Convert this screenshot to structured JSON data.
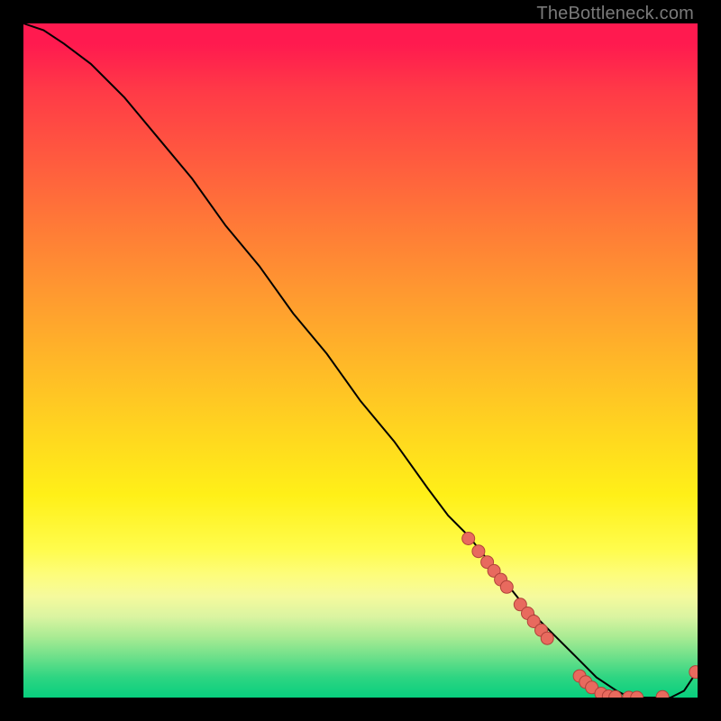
{
  "watermark": "TheBottleneck.com",
  "colors": {
    "background": "#000000",
    "curve_stroke": "#000000",
    "marker_fill": "#e86a5e",
    "marker_stroke": "#b0423a"
  },
  "chart_data": {
    "type": "line",
    "title": "",
    "xlabel": "",
    "ylabel": "",
    "xlim": [
      0,
      100
    ],
    "ylim": [
      0,
      100
    ],
    "grid": false,
    "legend": false,
    "series": [
      {
        "name": "bottleneck-curve",
        "x": [
          0,
          3,
          6,
          10,
          15,
          20,
          25,
          30,
          35,
          40,
          45,
          50,
          55,
          60,
          63,
          66,
          70,
          74,
          78,
          82,
          85,
          88,
          90,
          92,
          94,
          96,
          98,
          100
        ],
        "y": [
          100,
          99,
          97,
          94,
          89,
          83,
          77,
          70,
          64,
          57,
          51,
          44,
          38,
          31,
          27,
          24,
          19,
          14,
          10,
          6,
          3,
          1,
          0,
          0,
          0,
          0,
          1,
          4
        ]
      }
    ],
    "markers": [
      {
        "x": 66.0,
        "y": 23.6
      },
      {
        "x": 67.5,
        "y": 21.7
      },
      {
        "x": 68.8,
        "y": 20.1
      },
      {
        "x": 69.8,
        "y": 18.8
      },
      {
        "x": 70.8,
        "y": 17.5
      },
      {
        "x": 71.7,
        "y": 16.4
      },
      {
        "x": 73.7,
        "y": 13.8
      },
      {
        "x": 74.8,
        "y": 12.5
      },
      {
        "x": 75.7,
        "y": 11.3
      },
      {
        "x": 76.8,
        "y": 10.0
      },
      {
        "x": 77.7,
        "y": 8.8
      },
      {
        "x": 82.5,
        "y": 3.2
      },
      {
        "x": 83.4,
        "y": 2.3
      },
      {
        "x": 84.3,
        "y": 1.5
      },
      {
        "x": 85.7,
        "y": 0.6
      },
      {
        "x": 86.8,
        "y": 0.2
      },
      {
        "x": 87.8,
        "y": 0.1
      },
      {
        "x": 89.8,
        "y": 0.0
      },
      {
        "x": 91.0,
        "y": 0.0
      },
      {
        "x": 94.8,
        "y": 0.1
      },
      {
        "x": 99.7,
        "y": 3.8
      }
    ]
  }
}
